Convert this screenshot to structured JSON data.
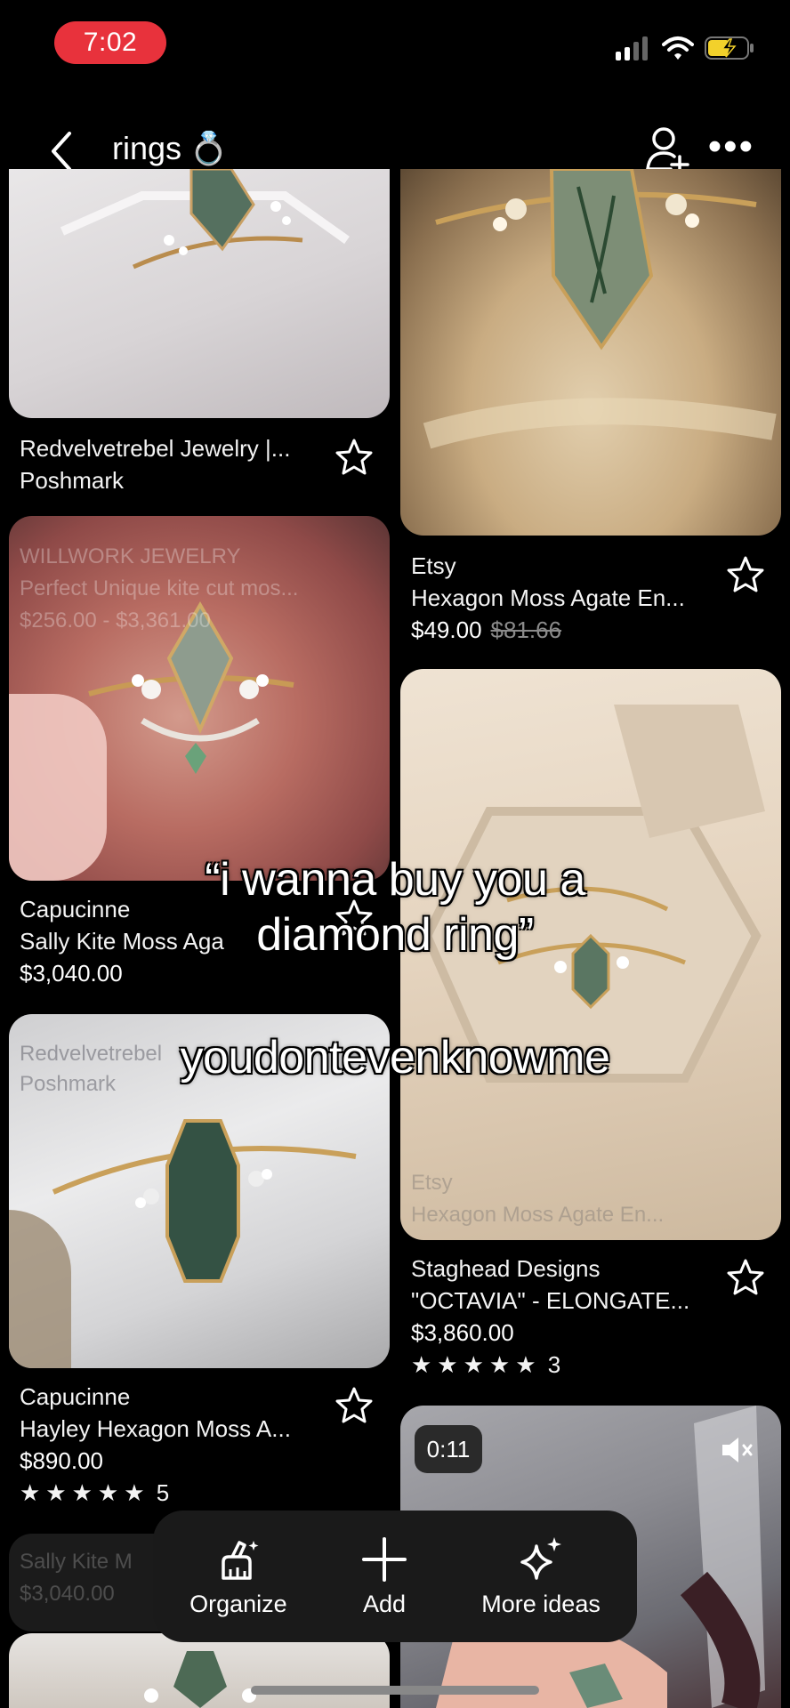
{
  "status": {
    "time": "7:02"
  },
  "header": {
    "title": "rings",
    "title_emoji": "💍"
  },
  "pins": [
    {
      "source": "Redvelvetrebel Jewelry |...",
      "subtitle": "Poshmark"
    },
    {
      "source": "Etsy",
      "subtitle": "Hexagon Moss Agate En...",
      "price": "$49.00",
      "old_price": "$81.66"
    },
    {
      "source": "Capucinne",
      "subtitle": "Sally Kite Moss Aga",
      "price": "$3,040.00"
    },
    {
      "source": "Staghead Designs",
      "subtitle": "\"OCTAVIA\" - ELONGATE...",
      "price": "$3,860.00",
      "rating_count": "3"
    },
    {
      "source": "Capucinne",
      "subtitle": "Hayley Hexagon Moss A...",
      "price": "$890.00",
      "rating_count": "5"
    }
  ],
  "faded": {
    "a1": "WILLWORK JEWELRY",
    "a2": "Perfect Unique kite cut mos...",
    "a3": "$256.00 - $3,361.00",
    "b1": "Redvelvetrebel",
    "b2": "Poshmark",
    "c1": "Etsy",
    "c2": "Hexagon Moss Agate En...",
    "d1": "Sally Kite M",
    "d2": "$3,040.00"
  },
  "video": {
    "duration": "0:11"
  },
  "overlay": {
    "quote_line1": "“i wanna buy you a",
    "quote_line2": "diamond ring”",
    "caption": "youdontevenknowme"
  },
  "toolbar": {
    "organize": "Organize",
    "add": "Add",
    "more_ideas": "More ideas"
  },
  "colors": {
    "time_pill": "#e8323c",
    "battery": "#f2d12b"
  }
}
